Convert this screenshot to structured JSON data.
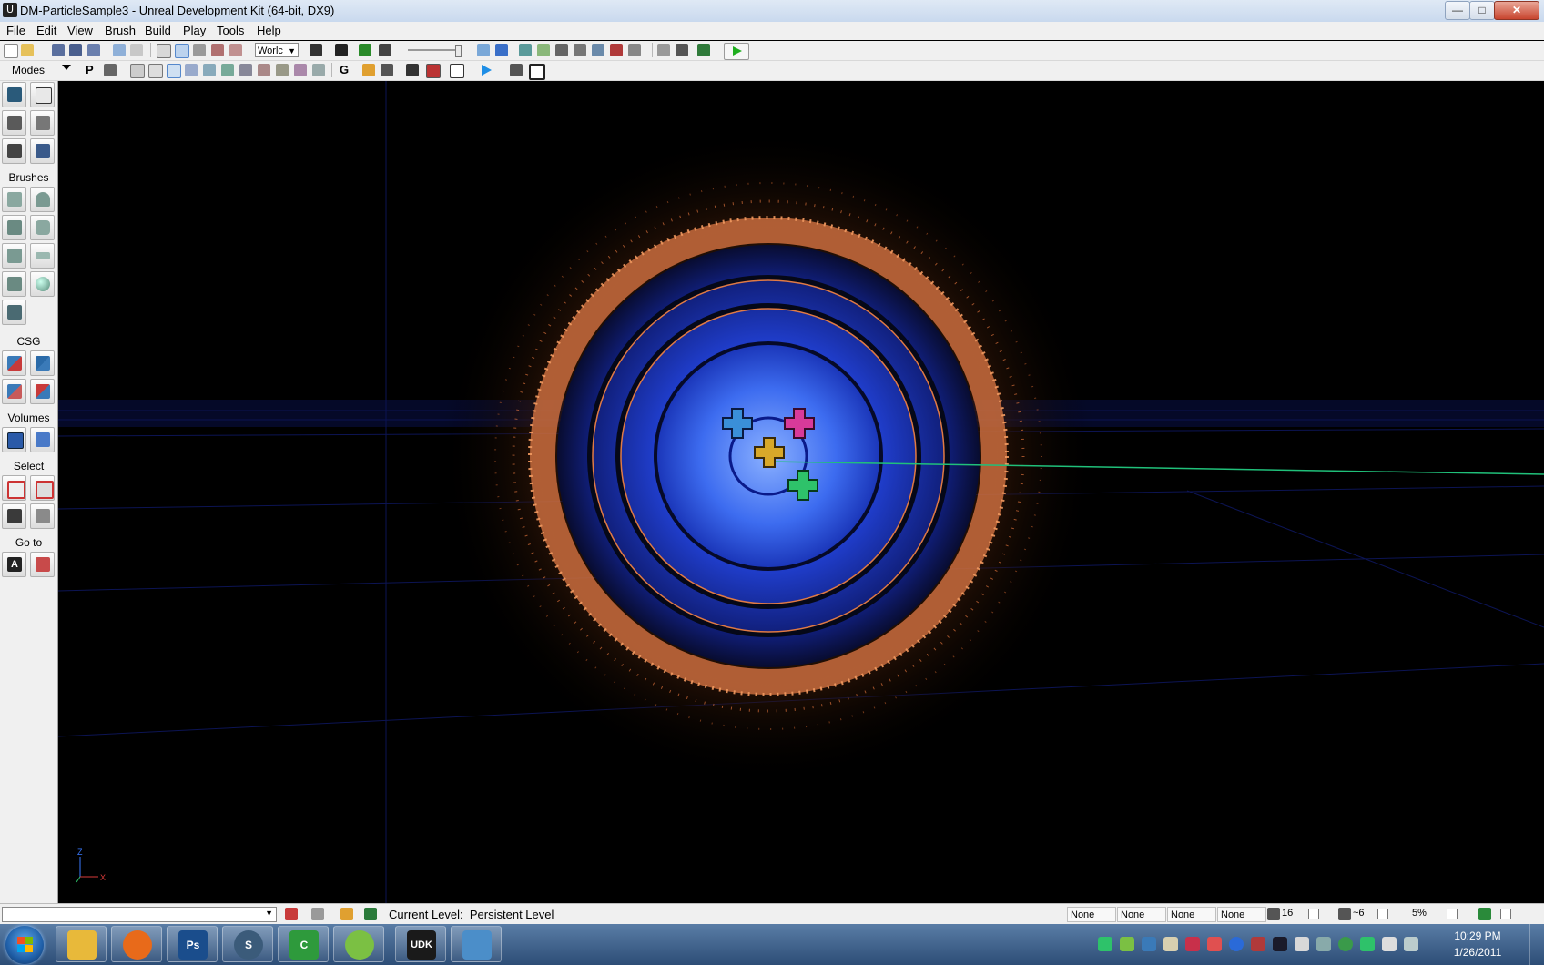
{
  "window": {
    "title": "DM-ParticleSample3 - Unreal Development Kit (64-bit, DX9)",
    "controls": {
      "minimize": "—",
      "maximize": "□",
      "close": "✕"
    }
  },
  "menu": [
    "File",
    "Edit",
    "View",
    "Brush",
    "Build",
    "Play",
    "Tools",
    "Help"
  ],
  "toolbar1": {
    "coordinate_system": "Worlc",
    "icons": [
      "new-icon",
      "open-icon",
      "save-icon",
      "save-all-icon",
      "undo-icon",
      "redo-icon",
      "select-icon",
      "translate-icon",
      "rotate-icon",
      "scale-icon",
      "non-uniform-scale-icon",
      "search-icon",
      "content-browser-icon",
      "kismet-icon",
      "matinee-icon",
      "build-geometry-icon",
      "build-lighting-icon",
      "build-paths-icon",
      "build-cover-icon",
      "build-all-icon",
      "lighting-quality-icon",
      "play-in-editor-icon"
    ]
  },
  "toolbar2": {
    "modes_label": "Modes",
    "p_label": "P",
    "g_label": "G",
    "icons": [
      "wireframe-icon",
      "unlit-icon",
      "lit-icon",
      "detail-lighting-icon",
      "lighting-only-icon",
      "light-complexity-icon",
      "texture-density-icon",
      "shader-complexity-icon",
      "lightmap-density-icon",
      "lock-icon",
      "eye-icon",
      "actor-icon",
      "camera-icon",
      "realtime-icon",
      "game-view-icon",
      "maximize-viewport-icon"
    ]
  },
  "panel": {
    "sections": {
      "brushes": "Brushes",
      "csg": "CSG",
      "volumes": "Volumes",
      "select": "Select",
      "goto": "Go to"
    },
    "tools": {
      "modes": [
        "camera-mode-icon",
        "geometry-mode-icon",
        "terrain-mode-icon",
        "texture-align-icon",
        "mesh-paint-icon",
        "static-mesh-icon"
      ],
      "brushes": [
        "cube-brush-icon",
        "cone-brush-icon",
        "curved-stair-icon",
        "cylinder-brush-icon",
        "linear-stair-icon",
        "sheet-brush-icon",
        "spiral-stair-icon",
        "sphere-brush-icon",
        "volumetric-brush-icon"
      ],
      "csg": [
        "csg-add-icon",
        "csg-subtract-icon",
        "csg-intersect-icon",
        "csg-deintersect-icon"
      ],
      "volumes": [
        "add-volume-icon",
        "volume-visibility-icon"
      ],
      "select": [
        "select-inside-icon",
        "select-outside-icon",
        "show-selected-icon",
        "hide-selected-icon"
      ],
      "goto": [
        "goto-actor-icon",
        "goto-builder-brush-icon"
      ]
    }
  },
  "viewport": {
    "axis_labels": {
      "z": "Z",
      "x": "X"
    },
    "colors": {
      "ring": "#e07a45",
      "core": "#1f3cc8",
      "glow": "#2a5bff"
    },
    "markers": [
      {
        "name": "blue-cross-marker",
        "color": "#3a8fd8"
      },
      {
        "name": "magenta-cross-marker",
        "color": "#d83a9a"
      },
      {
        "name": "gold-cross-marker",
        "color": "#d8a82a"
      },
      {
        "name": "green-cross-marker",
        "color": "#2ec26a"
      }
    ]
  },
  "statusbar": {
    "current_level_label": "Current Level:",
    "current_level_value": "Persistent Level",
    "fields": [
      "None",
      "None",
      "None",
      "None"
    ],
    "grid_size": "16",
    "rotation_snap": "~6",
    "scale_snap": "5%"
  },
  "taskbar": {
    "apps": [
      {
        "name": "explorer-icon",
        "label": "",
        "color": "#e8b93a"
      },
      {
        "name": "firefox-icon",
        "label": "",
        "color": "#e86a1a"
      },
      {
        "name": "photoshop-icon",
        "label": "Ps",
        "color": "#1a4d8c"
      },
      {
        "name": "steam-icon",
        "label": "S",
        "color": "#3b5b7a"
      },
      {
        "name": "cinema-icon",
        "label": "C",
        "color": "#2e9a3c"
      },
      {
        "name": "mascot-icon",
        "label": "",
        "color": "#7bc043"
      },
      {
        "name": "udk-icon",
        "label": "UDK",
        "color": "#1a1a1a"
      },
      {
        "name": "photo-viewer-icon",
        "label": "",
        "color": "#4b8ec9"
      }
    ],
    "clock": {
      "time": "10:29 PM",
      "date": "1/26/2011"
    }
  }
}
